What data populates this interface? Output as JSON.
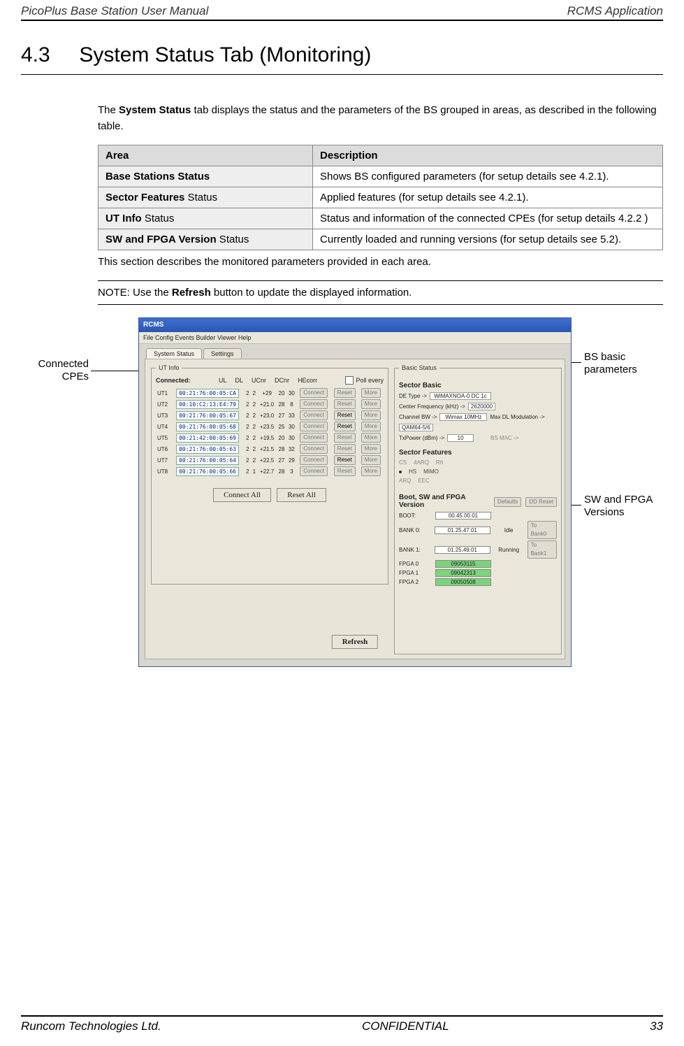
{
  "header": {
    "left": "PicoPlus Base Station User Manual",
    "right": "RCMS Application"
  },
  "section": {
    "number": "4.3",
    "title": "System Status Tab (Monitoring)"
  },
  "intro_pre": "The ",
  "intro_bold": "System Status",
  "intro_post": " tab displays the status and the parameters of the BS grouped in areas, as described in the following table.",
  "table": {
    "head_area": "Area",
    "head_desc": "Description",
    "rows": [
      {
        "area_bold": "Base Stations Status",
        "area_plain": "",
        "desc": "Shows BS configured parameters (for setup details see 4.2.1)."
      },
      {
        "area_bold": "Sector Features",
        "area_plain": " Status",
        "desc": "Applied features (for setup details see 4.2.1)."
      },
      {
        "area_bold": "UT Info",
        "area_plain": " Status",
        "desc": "Status and information of the connected CPEs (for setup details 4.2.2 )"
      },
      {
        "area_bold": "SW and FPGA Version",
        "area_plain": " Status",
        "desc": "Currently loaded and running versions (for setup details see 5.2)."
      }
    ]
  },
  "monitored": "This section describes the monitored parameters provided in each area.",
  "note_pre": "NOTE: Use the ",
  "note_bold": "Refresh",
  "note_post": " button to update the displayed information.",
  "screenshot": {
    "title": "RCMS",
    "menu": "File   Config   Events   Builder   Viewer   Help",
    "tabs": {
      "status": "System Status",
      "settings": "Settings"
    },
    "ut_info": {
      "group": "UT Info",
      "connected": "Connected:",
      "headers": [
        "",
        "UL",
        "DL",
        "UCnr",
        "DCnr",
        "HEcorr"
      ],
      "poll_label": "Poll every",
      "rows": [
        {
          "id": "UT1",
          "mac": "00:21:76:00:05:CA",
          "ul": "2",
          "dl": "2",
          "ucnr": "+29",
          "dcnr": "20",
          "he": "30"
        },
        {
          "id": "UT2",
          "mac": "00:10:C2:13:E4:79",
          "ul": "2",
          "dl": "2",
          "ucnr": "+21.0",
          "dcnr": "28",
          "he": "8"
        },
        {
          "id": "UT3",
          "mac": "00:21:76:00:05:67",
          "ul": "2",
          "dl": "2",
          "ucnr": "+23.0",
          "dcnr": "27",
          "he": "33"
        },
        {
          "id": "UT4",
          "mac": "00:21:76:00:05:68",
          "ul": "2",
          "dl": "2",
          "ucnr": "+23.5",
          "dcnr": "25",
          "he": "30"
        },
        {
          "id": "UT5",
          "mac": "00:21:42:00:05:69",
          "ul": "2",
          "dl": "2",
          "ucnr": "+19.5",
          "dcnr": "20",
          "he": "30"
        },
        {
          "id": "UT6",
          "mac": "00:21:76:00:05:63",
          "ul": "2",
          "dl": "2",
          "ucnr": "+21.5",
          "dcnr": "28",
          "he": "32"
        },
        {
          "id": "UT7",
          "mac": "00:21:76:00:05:64",
          "ul": "2",
          "dl": "2",
          "ucnr": "+22.5",
          "dcnr": "27",
          "he": "29"
        },
        {
          "id": "UT8",
          "mac": "00:21:76:00:05:66",
          "ul": "2",
          "dl": "1",
          "ucnr": "+22.7",
          "dcnr": "28",
          "he": "3"
        }
      ],
      "row_btns": {
        "connect": "Connect",
        "reset": "Reset",
        "more": "More"
      },
      "connect_all": "Connect All",
      "reset_all": "Reset All"
    },
    "basic": {
      "group": "Basic Status",
      "head": "Sector Basic",
      "de_type": "DE Type ->",
      "de_type_val": "WiMAXNOA-0 DC 1c",
      "cf": "Center Frequency (kHz) ->",
      "cf_val": "2620000",
      "bw": "Channel BW ->",
      "bw_val": "Wimax 10MHz",
      "mod": "Max DL Modulation ->",
      "mod_val": "QAM64-5/6",
      "txp": "TxPower (dBm) ->",
      "txp_val": "10",
      "mac": "BS MAC ->",
      "feat_head": "Sector Features",
      "feat": [
        "CS",
        "4ARQ",
        "R6",
        "HS",
        "MIMO",
        "ARQ",
        "EEC"
      ],
      "ver_head": "Boot, SW and FPGA Version",
      "defaults": "Defaults",
      "ddreset": "DD Reset",
      "fw_rows": [
        {
          "k": "BOOT:",
          "v": "00.45.00.01",
          "s": "",
          "b": ""
        },
        {
          "k": "BANK 0:",
          "v": "01.25.47.01",
          "s": "Idle",
          "b": "To Bank0"
        },
        {
          "k": "BANK 1:",
          "v": "01.25.49.01",
          "s": "Running",
          "b": "To Bank1"
        },
        {
          "k": "FPGA 0",
          "v": "09053115",
          "s": "",
          "b": ""
        },
        {
          "k": "FPGA 1",
          "v": "09042313",
          "s": "",
          "b": ""
        },
        {
          "k": "FPGA 2",
          "v": "09050508",
          "s": "",
          "b": ""
        }
      ]
    },
    "refresh": "Refresh"
  },
  "callouts": {
    "cpes": "Connected CPEs",
    "bs": "BS basic parameters",
    "fw": "SW and FPGA Versions"
  },
  "footer": {
    "left": "Runcom Technologies Ltd.",
    "center": "CONFIDENTIAL",
    "right": "33"
  }
}
